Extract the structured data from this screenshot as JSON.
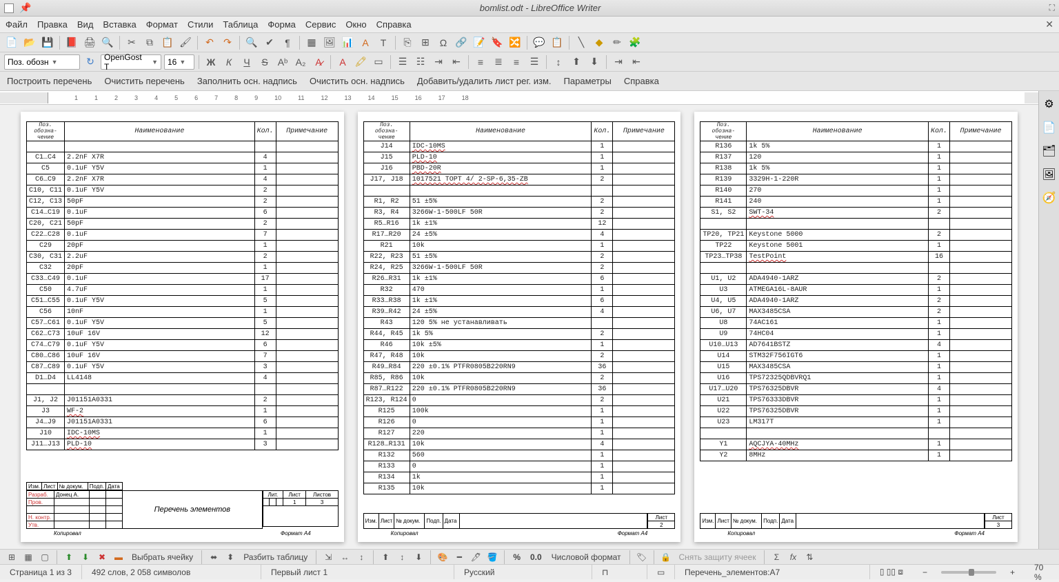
{
  "window": {
    "title": "bomlist.odt - LibreOffice Writer"
  },
  "menubar": [
    "Файл",
    "Правка",
    "Вид",
    "Вставка",
    "Формат",
    "Стили",
    "Таблица",
    "Форма",
    "Сервис",
    "Окно",
    "Справка"
  ],
  "toolbar2": {
    "style": "Поз. обозн",
    "font": "OpenGost T",
    "size": "16"
  },
  "toolbar3": [
    "Построить перечень",
    "Очистить перечень",
    "Заполнить осн. надпись",
    "Очистить осн. надпись",
    "Добавить/удалить лист рег. изм.",
    "Параметры",
    "Справка"
  ],
  "ruler_ticks": [
    "1",
    "1",
    "2",
    "3",
    "4",
    "5",
    "6",
    "7",
    "8",
    "9",
    "10",
    "11",
    "12",
    "13",
    "14",
    "15",
    "16",
    "17",
    "18"
  ],
  "headers": {
    "pos": "Поз. обозна- чение",
    "name": "Наименование",
    "qty": "Кол.",
    "note": "Примечание"
  },
  "page1_rows": [
    {
      "pos": "",
      "name": "",
      "qty": "",
      "note": ""
    },
    {
      "pos": "C1…C4",
      "name": "2.2nF  X7R",
      "qty": "4",
      "note": ""
    },
    {
      "pos": "C5",
      "name": "0.1uF  Y5V",
      "qty": "1",
      "note": ""
    },
    {
      "pos": "C6…C9",
      "name": "2.2nF  X7R",
      "qty": "4",
      "note": ""
    },
    {
      "pos": "C10, C11",
      "name": "0.1uF  Y5V",
      "qty": "2",
      "note": ""
    },
    {
      "pos": "C12, C13",
      "name": "50pF",
      "qty": "2",
      "note": ""
    },
    {
      "pos": "C14…C19",
      "name": "0.1uF",
      "qty": "6",
      "note": ""
    },
    {
      "pos": "C20, C21",
      "name": "50pF",
      "qty": "2",
      "note": ""
    },
    {
      "pos": "C22…C28",
      "name": "0.1uF",
      "qty": "7",
      "note": ""
    },
    {
      "pos": "C29",
      "name": "20pF",
      "qty": "1",
      "note": ""
    },
    {
      "pos": "C30, C31",
      "name": "2.2uF",
      "qty": "2",
      "note": ""
    },
    {
      "pos": "C32",
      "name": "20pF",
      "qty": "1",
      "note": ""
    },
    {
      "pos": "C33…C49",
      "name": "0.1uF",
      "qty": "17",
      "note": ""
    },
    {
      "pos": "C50",
      "name": "4.7uF",
      "qty": "1",
      "note": ""
    },
    {
      "pos": "C51…C55",
      "name": "0.1uF  Y5V",
      "qty": "5",
      "note": ""
    },
    {
      "pos": "C56",
      "name": "10nF",
      "qty": "1",
      "note": ""
    },
    {
      "pos": "C57…C61",
      "name": "0.1uF  Y5V",
      "qty": "5",
      "note": ""
    },
    {
      "pos": "C62…C73",
      "name": "10uF  16V",
      "qty": "12",
      "note": ""
    },
    {
      "pos": "C74…C79",
      "name": "0.1uF  Y5V",
      "qty": "6",
      "note": ""
    },
    {
      "pos": "C80…C86",
      "name": "10uF  16V",
      "qty": "7",
      "note": ""
    },
    {
      "pos": "C87…C89",
      "name": "0.1uF  Y5V",
      "qty": "3",
      "note": ""
    },
    {
      "pos": "D1…D4",
      "name": "LL4148",
      "qty": "4",
      "note": ""
    },
    {
      "pos": "",
      "name": "",
      "qty": "",
      "note": ""
    },
    {
      "pos": "J1, J2",
      "name": "J01151A0331",
      "qty": "2",
      "note": ""
    },
    {
      "pos": "J3",
      "name": "WF-2",
      "qty": "1",
      "note": "",
      "wavy": true
    },
    {
      "pos": "J4…J9",
      "name": "J01151A0331",
      "qty": "6",
      "note": ""
    },
    {
      "pos": "J10",
      "name": "IDC-10MS",
      "qty": "1",
      "note": "",
      "wavy": true
    },
    {
      "pos": "J11…J13",
      "name": "PLD-10",
      "qty": "3",
      "note": "",
      "wavy": true
    }
  ],
  "page2_rows": [
    {
      "pos": "J14",
      "name": "IDC-10MS",
      "qty": "1",
      "note": "",
      "wavy": true
    },
    {
      "pos": "J15",
      "name": "PLD-10",
      "qty": "1",
      "note": "",
      "wavy": true
    },
    {
      "pos": "J16",
      "name": "PBD-20R",
      "qty": "1",
      "note": "",
      "wavy": true
    },
    {
      "pos": "J17, J18",
      "name": "1017521 TOPT 4/ 2-SP-6,35-ZB",
      "qty": "2",
      "note": "",
      "wavy": true
    },
    {
      "pos": "",
      "name": "",
      "qty": "",
      "note": ""
    },
    {
      "pos": "R1, R2",
      "name": "51 ±5%",
      "qty": "2",
      "note": ""
    },
    {
      "pos": "R3, R4",
      "name": "3266W-1-500LF 50R",
      "qty": "2",
      "note": ""
    },
    {
      "pos": "R5…R16",
      "name": "1k ±1%",
      "qty": "12",
      "note": ""
    },
    {
      "pos": "R17…R20",
      "name": "24 ±5%",
      "qty": "4",
      "note": ""
    },
    {
      "pos": "R21",
      "name": "10k",
      "qty": "1",
      "note": ""
    },
    {
      "pos": "R22, R23",
      "name": "51 ±5%",
      "qty": "2",
      "note": ""
    },
    {
      "pos": "R24, R25",
      "name": "3266W-1-500LF 50R",
      "qty": "2",
      "note": ""
    },
    {
      "pos": "R26…R31",
      "name": "1k ±1%",
      "qty": "6",
      "note": ""
    },
    {
      "pos": "R32",
      "name": "470",
      "qty": "1",
      "note": ""
    },
    {
      "pos": "R33…R38",
      "name": "1k ±1%",
      "qty": "6",
      "note": ""
    },
    {
      "pos": "R39…R42",
      "name": "24 ±5%",
      "qty": "4",
      "note": ""
    },
    {
      "pos": "R43",
      "name": "120 5% не устанавливать",
      "qty": "",
      "note": ""
    },
    {
      "pos": "R44, R45",
      "name": "1k 5%",
      "qty": "2",
      "note": ""
    },
    {
      "pos": "R46",
      "name": "10k ±5%",
      "qty": "1",
      "note": ""
    },
    {
      "pos": "R47, R48",
      "name": "10k",
      "qty": "2",
      "note": ""
    },
    {
      "pos": "R49…R84",
      "name": "220 ±0.1% PTFR0805B220RN9",
      "qty": "36",
      "note": ""
    },
    {
      "pos": "R85, R86",
      "name": "10k",
      "qty": "2",
      "note": ""
    },
    {
      "pos": "R87…R122",
      "name": "220 ±0.1% PTFR0805B220RN9",
      "qty": "36",
      "note": ""
    },
    {
      "pos": "R123, R124",
      "name": "0",
      "qty": "2",
      "note": ""
    },
    {
      "pos": "R125",
      "name": "100k",
      "qty": "1",
      "note": ""
    },
    {
      "pos": "R126",
      "name": "0",
      "qty": "1",
      "note": ""
    },
    {
      "pos": "R127",
      "name": "220",
      "qty": "1",
      "note": ""
    },
    {
      "pos": "R128…R131",
      "name": "10k",
      "qty": "4",
      "note": ""
    },
    {
      "pos": "R132",
      "name": "560",
      "qty": "1",
      "note": ""
    },
    {
      "pos": "R133",
      "name": "0",
      "qty": "1",
      "note": ""
    },
    {
      "pos": "R134",
      "name": "1k",
      "qty": "1",
      "note": ""
    },
    {
      "pos": "R135",
      "name": "10k",
      "qty": "1",
      "note": ""
    }
  ],
  "page3_rows": [
    {
      "pos": "R136",
      "name": "1k 5%",
      "qty": "1",
      "note": ""
    },
    {
      "pos": "R137",
      "name": "120",
      "qty": "1",
      "note": ""
    },
    {
      "pos": "R138",
      "name": "1k 5%",
      "qty": "1",
      "note": ""
    },
    {
      "pos": "R139",
      "name": "3329H-1-220R",
      "qty": "1",
      "note": ""
    },
    {
      "pos": "R140",
      "name": "270",
      "qty": "1",
      "note": ""
    },
    {
      "pos": "R141",
      "name": "240",
      "qty": "1",
      "note": ""
    },
    {
      "pos": "S1, S2",
      "name": "SWT-34",
      "qty": "2",
      "note": "",
      "wavy": true
    },
    {
      "pos": "",
      "name": "",
      "qty": "",
      "note": ""
    },
    {
      "pos": "TP20, TP21",
      "name": "Keystone 5000",
      "qty": "2",
      "note": ""
    },
    {
      "pos": "TP22",
      "name": "Keystone 5001",
      "qty": "1",
      "note": ""
    },
    {
      "pos": "TP23…TP38",
      "name": "TestPoint",
      "qty": "16",
      "note": "",
      "wavy": true
    },
    {
      "pos": "",
      "name": "",
      "qty": "",
      "note": ""
    },
    {
      "pos": "U1, U2",
      "name": "ADA4940-1ARZ",
      "qty": "2",
      "note": ""
    },
    {
      "pos": "U3",
      "name": "ATMEGA16L-8AUR",
      "qty": "1",
      "note": ""
    },
    {
      "pos": "U4, U5",
      "name": "ADA4940-1ARZ",
      "qty": "2",
      "note": ""
    },
    {
      "pos": "U6, U7",
      "name": "MAX3485CSA",
      "qty": "2",
      "note": ""
    },
    {
      "pos": "U8",
      "name": "74AC161",
      "qty": "1",
      "note": ""
    },
    {
      "pos": "U9",
      "name": "74HC04",
      "qty": "1",
      "note": ""
    },
    {
      "pos": "U10…U13",
      "name": "AD7641BSTZ",
      "qty": "4",
      "note": ""
    },
    {
      "pos": "U14",
      "name": "STM32F756IGT6",
      "qty": "1",
      "note": ""
    },
    {
      "pos": "U15",
      "name": "MAX3485CSA",
      "qty": "1",
      "note": ""
    },
    {
      "pos": "U16",
      "name": "TPS72325QDBVRQ1",
      "qty": "1",
      "note": ""
    },
    {
      "pos": "U17…U20",
      "name": "TPS76325DBVR",
      "qty": "4",
      "note": ""
    },
    {
      "pos": "U21",
      "name": "TPS76333DBVR",
      "qty": "1",
      "note": ""
    },
    {
      "pos": "U22",
      "name": "TPS76325DBVR",
      "qty": "1",
      "note": ""
    },
    {
      "pos": "U23",
      "name": "LM317T",
      "qty": "1",
      "note": ""
    },
    {
      "pos": "",
      "name": "",
      "qty": "",
      "note": ""
    },
    {
      "pos": "Y1",
      "name": "AQCJYA-40MHz",
      "qty": "1",
      "note": "",
      "wavy": true
    },
    {
      "pos": "Y2",
      "name": "8MHz",
      "qty": "1",
      "note": ""
    }
  ],
  "titleblock": {
    "cols": [
      "Изм.",
      "Лист",
      "№ докум.",
      "Подп.",
      "Дата"
    ],
    "razrab": "Разраб.",
    "razrab_name": "Донец А.",
    "prov": "Пров.",
    "nkontr": "Н. контр.",
    "utv": "Утв.",
    "center": "Перечень элементов",
    "lit": "Лит.",
    "list": "Лист",
    "listov": "Листов",
    "list_val": "1",
    "listov_val": "3",
    "kopiroval": "Копировал",
    "format": "Формат A4",
    "list2": "2",
    "list3": "3"
  },
  "bottombar": {
    "select_cell": "Выбрать ячейку",
    "split_table": "Разбить таблицу",
    "num_format": "Числовой формат",
    "unprotect": "Снять защиту ячеек",
    "percent": "%",
    "zero": "0.0"
  },
  "statusbar": {
    "page": "Страница 1 из 3",
    "words": "492 слов, 2 058 символов",
    "sheet": "Первый лист 1",
    "lang": "Русский",
    "sel": "Перечень_элементов:A7",
    "zoom": "70 %"
  }
}
